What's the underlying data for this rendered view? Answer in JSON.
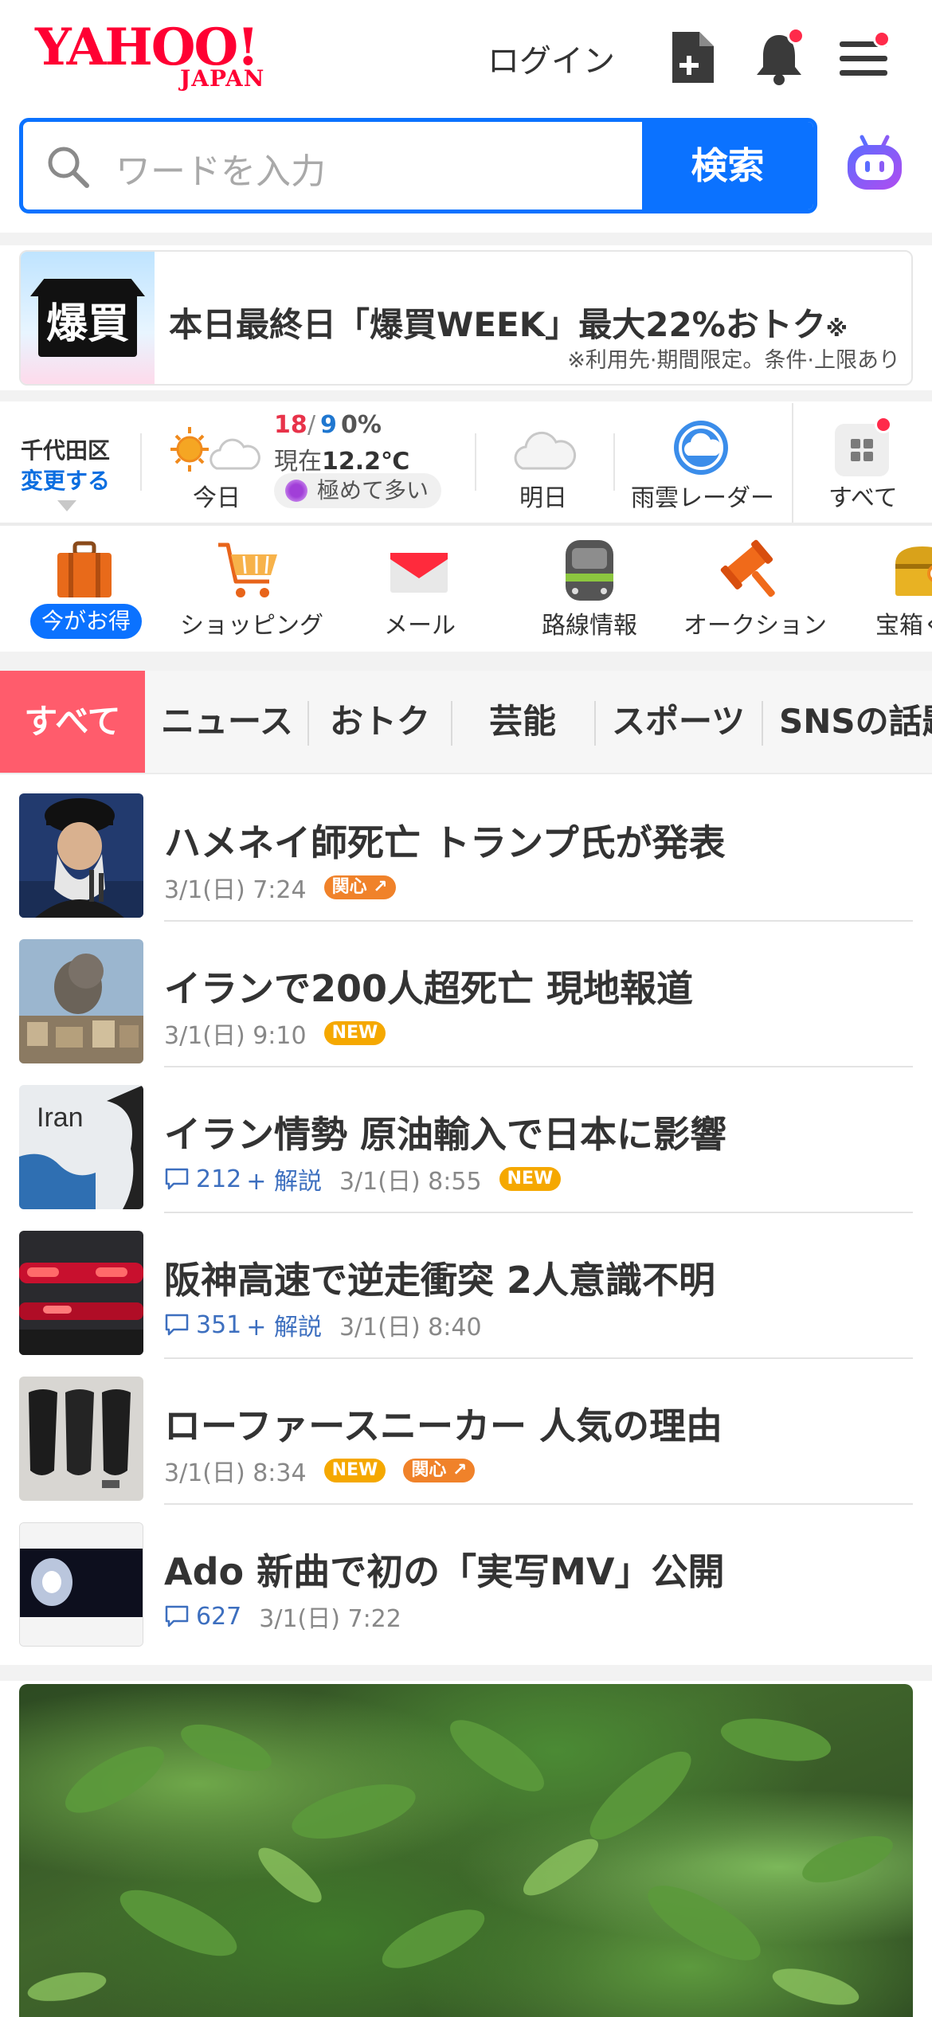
{
  "header": {
    "logo_text": "YAHOO!",
    "logo_sub": "JAPAN",
    "login_label": "ログイン"
  },
  "search": {
    "placeholder": "ワードを入力",
    "button_label": "検索"
  },
  "banner": {
    "image_text": "爆買",
    "title": "本日最終日「爆買WEEK」最大22%おトク",
    "title_mark": "※",
    "note": "※利用先·期間限定。条件·上限あり"
  },
  "weather": {
    "location": "千代田区",
    "change_label": "変更する",
    "today_label": "今日",
    "high": "18",
    "slash": "/",
    "low": "9",
    "rain": "0%",
    "current_prefix": "現在",
    "current_temp": "12.2℃",
    "pollen": "極めて多い",
    "tomorrow_label": "明日",
    "radar_label": "雨雲レーダー",
    "all_label": "すべて"
  },
  "services": [
    {
      "label": "今がお得",
      "icon": "suitcase-icon"
    },
    {
      "label": "ショッピング",
      "icon": "cart-icon"
    },
    {
      "label": "メール",
      "icon": "mail-icon"
    },
    {
      "label": "路線情報",
      "icon": "train-icon"
    },
    {
      "label": "オークション",
      "icon": "gavel-icon"
    },
    {
      "label": "宝箱く",
      "icon": "treasure-icon"
    }
  ],
  "tabs": [
    "すべて",
    "ニュース",
    "おトク",
    "芸能",
    "スポーツ",
    "SNSの話題"
  ],
  "news": [
    {
      "title": "ハメネイ師死亡 トランプ氏が発表",
      "time": "3/1(日) 7:24",
      "comments": "",
      "kaisetsu": "",
      "tags": [
        "関心"
      ]
    },
    {
      "title": "イランで200人超死亡 現地報道",
      "time": "3/1(日) 9:10",
      "comments": "",
      "kaisetsu": "",
      "tags": [
        "NEW"
      ]
    },
    {
      "title": "イラン情勢 原油輸入で日本に影響",
      "time": "3/1(日) 8:55",
      "comments": "212",
      "kaisetsu": "+ 解説",
      "tags": [
        "NEW"
      ]
    },
    {
      "title": "阪神高速で逆走衝突 2人意識不明",
      "time": "3/1(日) 8:40",
      "comments": "351",
      "kaisetsu": "+ 解説",
      "tags": []
    },
    {
      "title": "ローファースニーカー 人気の理由",
      "time": "3/1(日) 8:34",
      "comments": "",
      "kaisetsu": "",
      "tags": [
        "NEW",
        "関心"
      ]
    },
    {
      "title": "Ado 新曲で初の「実写MV」公開",
      "time": "3/1(日) 7:22",
      "comments": "627",
      "kaisetsu": "",
      "tags": []
    }
  ],
  "thumb_text": {
    "iran": "Iran"
  },
  "colors": {
    "brand_red": "#ff0033",
    "search_blue": "#0b72ff",
    "tab_active": "#ff5c6c",
    "tag_new": "#f5a800",
    "tag_kanshin": "#f0822a",
    "comment_blue": "#3d6fbf"
  }
}
